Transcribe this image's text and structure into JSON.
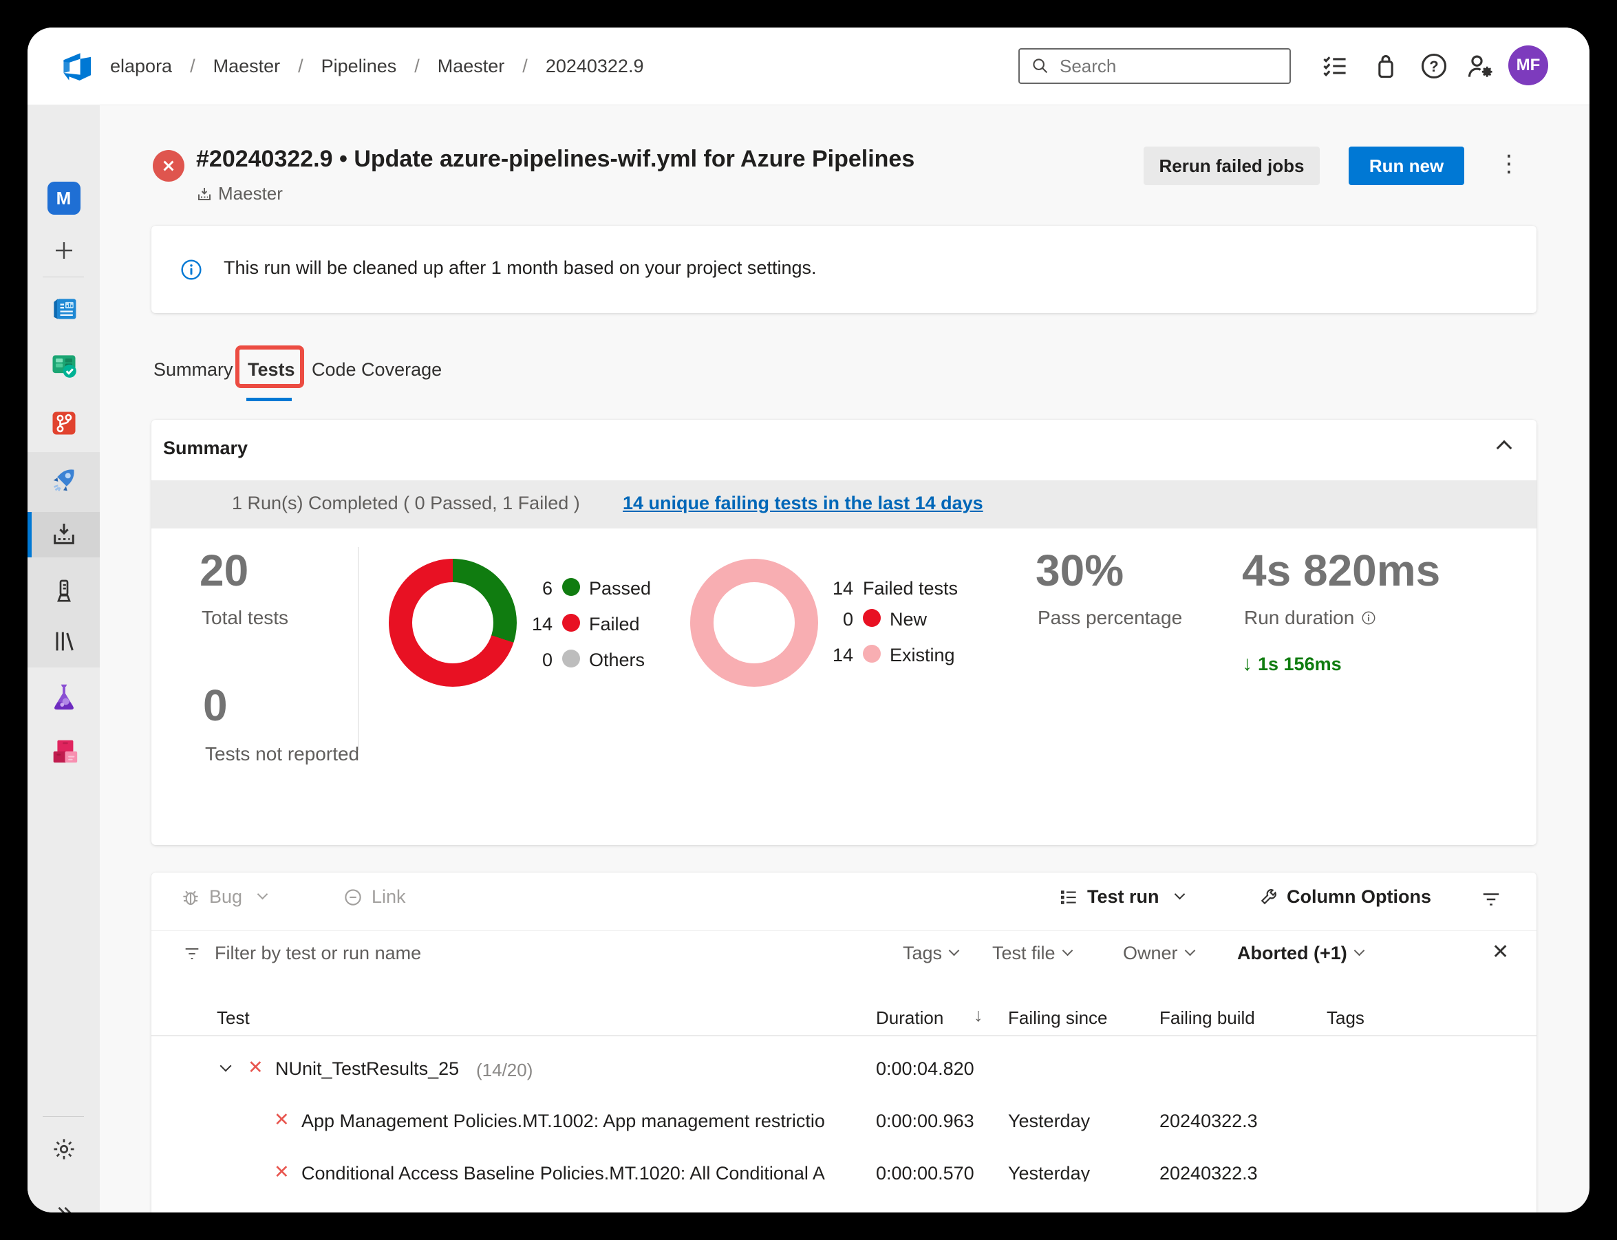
{
  "topbar": {
    "breadcrumbs": [
      "elapora",
      "Maester",
      "Pipelines",
      "Maester",
      "20240322.9"
    ],
    "search_placeholder": "Search",
    "avatar_initials": "MF",
    "avatar_color": "#7d3bbd"
  },
  "sidebar": {
    "project_initial": "M",
    "icons": [
      "project-avatar",
      "add-project",
      "overview",
      "boards",
      "repos",
      "pipelines",
      "runs",
      "environments",
      "library",
      "test-plans",
      "artifacts",
      "settings",
      "expand"
    ]
  },
  "header": {
    "title": "#20240322.9 • Update azure-pipelines-wif.yml for Azure Pipelines",
    "pipeline_name": "Maester",
    "rerun_label": "Rerun failed jobs",
    "run_new_label": "Run new",
    "status": "failed"
  },
  "banner": {
    "message": "This run will be cleaned up after 1 month based on your project settings."
  },
  "tabs": [
    {
      "label": "Summary"
    },
    {
      "label": "Tests"
    },
    {
      "label": "Code Coverage"
    }
  ],
  "summary": {
    "title": "Summary",
    "runs_line": "1 Run(s) Completed ( 0 Passed, 1 Failed )",
    "failing_link": "14 unique failing tests in the last 14 days",
    "total": {
      "value": "20",
      "label": "Total tests"
    },
    "not_reported": {
      "value": "0",
      "label": "Tests not reported"
    },
    "pass": {
      "value": "30%",
      "label": "Pass percentage"
    },
    "duration": {
      "value": "4s 820ms",
      "label": "Run duration",
      "delta": "1s 156ms",
      "delta_color": "#107c10"
    },
    "legend_results": [
      {
        "count": "6",
        "label": "Passed",
        "color": "#107c10"
      },
      {
        "count": "14",
        "label": "Failed",
        "color": "#e81123"
      },
      {
        "count": "0",
        "label": "Others",
        "color": "#bdbdbd"
      }
    ],
    "legend_failed": {
      "header_count": "14",
      "header_label": "Failed tests",
      "items": [
        {
          "count": "0",
          "label": "New",
          "color": "#e81123"
        },
        {
          "count": "14",
          "label": "Existing",
          "color": "#f8aeb2"
        }
      ]
    },
    "chart_data": [
      {
        "type": "donut",
        "title": "Test results",
        "total": 20,
        "segments": [
          {
            "label": "Passed",
            "value": 6,
            "color": "#107c10"
          },
          {
            "label": "Failed",
            "value": 14,
            "color": "#e81123"
          },
          {
            "label": "Others",
            "value": 0,
            "color": "#bdbdbd"
          }
        ]
      },
      {
        "type": "donut",
        "title": "Failed tests",
        "total": 14,
        "segments": [
          {
            "label": "New",
            "value": 0,
            "color": "#e81123"
          },
          {
            "label": "Existing",
            "value": 14,
            "color": "#f8aeb2"
          }
        ]
      }
    ]
  },
  "results": {
    "toolbar": {
      "bug": "Bug",
      "link": "Link",
      "test_run": "Test run",
      "column_options": "Column Options"
    },
    "filter_placeholder": "Filter by test or run name",
    "dropdowns": [
      {
        "label": "Tags",
        "active": false
      },
      {
        "label": "Test file",
        "active": false
      },
      {
        "label": "Owner",
        "active": false
      },
      {
        "label": "Aborted (+1)",
        "active": true
      }
    ],
    "columns": [
      "Test",
      "Duration",
      "Failing since",
      "Failing build",
      "Tags"
    ],
    "rows": [
      {
        "name": "NUnit_TestResults_25",
        "meta": "(14/20)",
        "duration": "0:00:04.820",
        "failing_since": "",
        "failing_build": "",
        "expandable": true
      },
      {
        "name": "App Management Policies.MT.1002: App management restrictio",
        "duration": "0:00:00.963",
        "failing_since": "Yesterday",
        "failing_build": "20240322.3",
        "expandable": false
      },
      {
        "name": "Conditional Access Baseline Policies.MT.1020: All Conditional A",
        "duration": "0:00:00.570",
        "failing_since": "Yesterday",
        "failing_build": "20240322.3",
        "expandable": false
      }
    ]
  }
}
